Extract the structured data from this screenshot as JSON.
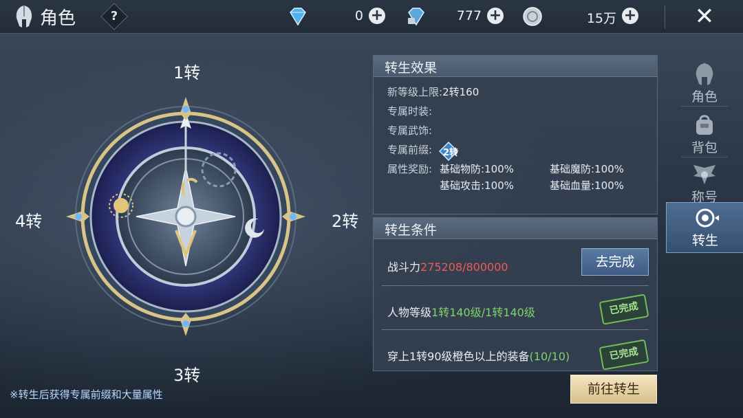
{
  "header": {
    "title": "角色",
    "help_label": "?",
    "close_label": "✕",
    "currencies": [
      {
        "icon": "diamond-icon",
        "value": "0",
        "plus": "+"
      },
      {
        "icon": "bound-diamond-icon",
        "value": "777",
        "plus": "+"
      },
      {
        "icon": "silver-coin-icon",
        "value": "15万",
        "plus": "+"
      }
    ]
  },
  "compass": {
    "top_label": "1转",
    "right_label": "2转",
    "bottom_label": "3转",
    "left_label": "4转"
  },
  "side_tabs": [
    {
      "label": "角色",
      "icon": "helmet-icon",
      "active": false
    },
    {
      "label": "背包",
      "icon": "bag-icon",
      "active": false
    },
    {
      "label": "称号",
      "icon": "wings-badge-icon",
      "active": false
    },
    {
      "label": "转生",
      "icon": "rebirth-icon",
      "active": true
    }
  ],
  "effects": {
    "heading": "转生效果",
    "level_cap_label": "新等级上限:",
    "level_cap_value": "2转160",
    "costume_label": "专属时装:",
    "ornament_label": "专属武饰:",
    "prefix_label": "专属前缀:",
    "prefix_badge": "2转",
    "attr_label": "属性奖励:",
    "attrs": [
      "基础物防:100%",
      "基础魔防:100%",
      "基础攻击:100%",
      "基础血量:100%"
    ]
  },
  "conditions": {
    "heading": "转生条件",
    "power_label": "战斗力",
    "power_value": "275208/800000",
    "goto_button": "去完成",
    "level_label": "人物等级",
    "level_value": "1转140级/1转140级",
    "equip_label": "穿上1转90级橙色以上的装备",
    "equip_value": "(10/10)",
    "done_stamp": "已完成"
  },
  "rebirth_button": "前往转生",
  "footnote": "※转生后获得专属前缀和大量属性",
  "colors": {
    "accent_green": "#7fd36a",
    "accent_red": "#ee5a5a",
    "gold": "#d7c08c"
  }
}
